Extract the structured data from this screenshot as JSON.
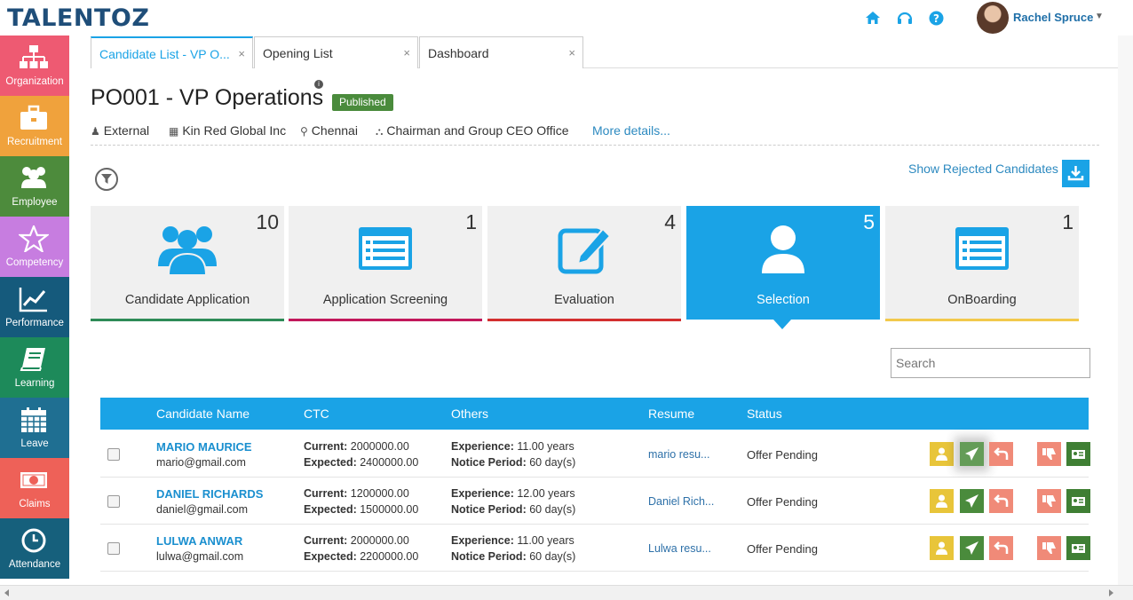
{
  "header": {
    "logo": "TALENTOZ",
    "user_name": "Rachel Spruce"
  },
  "sidebar": {
    "items": [
      {
        "label": "Organization",
        "color": "#ee5a72"
      },
      {
        "label": "Recruitment",
        "color": "#f0a23c"
      },
      {
        "label": "Employee",
        "color": "#4d8b3c"
      },
      {
        "label": "Competency",
        "color": "#c77de0"
      },
      {
        "label": "Performance",
        "color": "#155a7c"
      },
      {
        "label": "Learning",
        "color": "#1d8a5a"
      },
      {
        "label": "Leave",
        "color": "#1f6f92"
      },
      {
        "label": "Claims",
        "color": "#ee6158"
      },
      {
        "label": "Attendance",
        "color": "#16607c"
      }
    ]
  },
  "tabs": [
    {
      "label": "Candidate List - VP O...",
      "close": "×"
    },
    {
      "label": "Opening List",
      "close": "×"
    },
    {
      "label": "Dashboard",
      "close": "×"
    }
  ],
  "opening": {
    "title": "PO001 - VP Operations",
    "info": "i",
    "status": "Published",
    "type": "External",
    "company": "Kin Red Global Inc",
    "location": "Chennai",
    "department": "Chairman and Group CEO Office",
    "more_link": "More details..."
  },
  "show_rejected": "Show Rejected Candidates",
  "stages": [
    {
      "label": "Candidate Application",
      "count": "10",
      "bar_color": "#2e8b57"
    },
    {
      "label": "Application Screening",
      "count": "1",
      "bar_color": "#c2185b"
    },
    {
      "label": "Evaluation",
      "count": "4",
      "bar_color": "#d32f2f"
    },
    {
      "label": "Selection",
      "count": "5",
      "bar_color": "#1aa3e6"
    },
    {
      "label": "OnBoarding",
      "count": "1",
      "bar_color": "#f2c94c"
    }
  ],
  "search": {
    "placeholder": "Search"
  },
  "table": {
    "columns": [
      "Candidate Name",
      "CTC",
      "Others",
      "Resume",
      "Status"
    ],
    "current_label": "Current:",
    "expected_label": "Expected:",
    "experience_label": "Experience:",
    "notice_label": "Notice Period:",
    "rows": [
      {
        "name": "MARIO MAURICE",
        "email": "mario@gmail.com",
        "current": "2000000.00",
        "expected": "2400000.00",
        "experience": "11.00 years",
        "notice": "60 day(s)",
        "resume": "mario resu...",
        "status": "Offer Pending"
      },
      {
        "name": "DANIEL RICHARDS",
        "email": "daniel@gmail.com",
        "current": "1200000.00",
        "expected": "1500000.00",
        "experience": "12.00 years",
        "notice": "60 day(s)",
        "resume": "Daniel Rich...",
        "status": "Offer Pending"
      },
      {
        "name": "LULWA ANWAR",
        "email": "lulwa@gmail.com",
        "current": "2000000.00",
        "expected": "2200000.00",
        "experience": "11.00 years",
        "notice": "60 day(s)",
        "resume": "Lulwa resu...",
        "status": "Offer Pending"
      }
    ]
  },
  "colors": {
    "accent": "#1aa3e6",
    "action_profile": "#e8c53a",
    "action_send": "#4a8b3c",
    "action_revert": "#f08a78",
    "action_reject": "#f08a78",
    "action_hire": "#3f7f34"
  }
}
